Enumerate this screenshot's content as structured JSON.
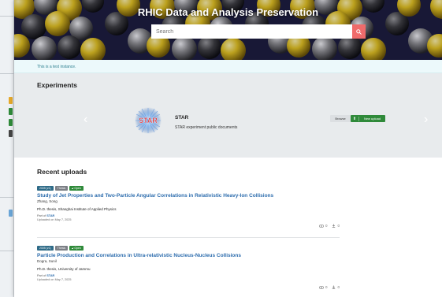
{
  "header": {
    "title": "RHIC Data and Analysis Preservation",
    "search_placeholder": "Search"
  },
  "notice": "This is a test instance.",
  "experiments": {
    "heading": "Experiments",
    "items": [
      {
        "name": "STAR",
        "logo_text": "STAR",
        "description": "STAR experiment public documents",
        "browse_label": "Browse",
        "upload_label": "New upload"
      }
    ]
  },
  "recent": {
    "heading": "Recent uploads",
    "items": [
      {
        "year": "2005 (v1)",
        "type": "Thesis",
        "access": "Open",
        "title": "Study of Jet Properties and Two-Particle Angular Correlations in Relativistic Heavy-Ion Collisions",
        "author": "Zhang, Song",
        "thesis": "Ph.D. thesis, Shanghai Institute of Applied Physics",
        "part_of_label": "Part of",
        "part_of_link": "STAR",
        "uploaded": "Uploaded on May 7, 2025",
        "views": "0",
        "downloads": "0"
      },
      {
        "year": "2005 (v1)",
        "type": "Thesis",
        "access": "Open",
        "title": "Particle Production and Correlations in Ultra-relativistic Nucleus-Nucleus Collisions",
        "author": "Dogra, Sunil",
        "thesis": "Ph.D. thesis, University of Jammu",
        "part_of_label": "Part of",
        "part_of_link": "STAR",
        "uploaded": "Uploaded on May 7, 2025",
        "views": "0",
        "downloads": "0"
      }
    ]
  },
  "colors": {
    "accent_link": "#2c6cad",
    "search_button": "#ef6b6b",
    "upload_button": "#2f8a3a",
    "year_badge": "#2d6a87",
    "type_badge": "#7b7f85",
    "notice_text": "#2d7f8f"
  },
  "icons": {
    "search": "search-icon",
    "upload": "upload-icon",
    "views": "eye-icon",
    "downloads": "download-icon",
    "access": "unlock-icon",
    "carousel_prev": "chevron-left-icon",
    "carousel_next": "chevron-right-icon"
  }
}
